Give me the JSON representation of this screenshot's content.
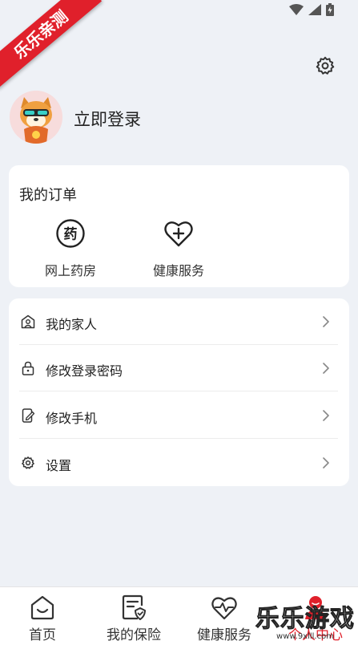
{
  "watermark": {
    "corner": "乐乐亲测",
    "brand": "乐乐游戏",
    "url": "www.9xlll.com"
  },
  "profile": {
    "login_label": "立即登录"
  },
  "orders": {
    "title": "我的订单",
    "items": [
      {
        "label": "网上药房",
        "icon": "pharmacy-icon"
      },
      {
        "label": "健康服务",
        "icon": "heart-plus-icon"
      }
    ]
  },
  "menu": {
    "items": [
      {
        "label": "我的家人",
        "icon": "family-icon"
      },
      {
        "label": "修改登录密码",
        "icon": "lock-icon"
      },
      {
        "label": "修改手机",
        "icon": "phone-edit-icon"
      },
      {
        "label": "设置",
        "icon": "gear-icon"
      }
    ]
  },
  "bottom_nav": {
    "items": [
      {
        "label": "首页",
        "icon": "home-icon"
      },
      {
        "label": "我的保险",
        "icon": "insurance-icon"
      },
      {
        "label": "健康服务",
        "icon": "heart-pulse-icon"
      },
      {
        "label": "个人中心",
        "icon": "person-icon",
        "active": true
      }
    ]
  },
  "colors": {
    "accent": "#e0202b",
    "background": "#eef1f6",
    "card": "#ffffff"
  }
}
